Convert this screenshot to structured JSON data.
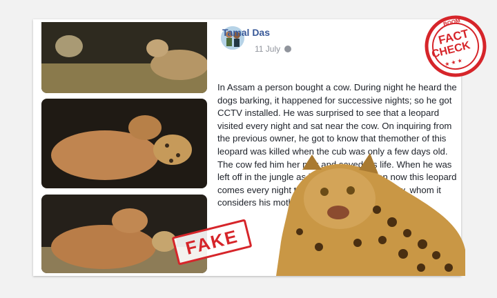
{
  "post": {
    "author": "Tamal Das",
    "date": "11 July",
    "privacy_icon": "globe-icon",
    "text": "In Assam a person bought a cow. During night he heard the dogs barking, it happened for successive nights; so he got CCTV installed. He was surprised to see that a leopard visited every night and sat near the cow. On inquiring from the previous owner, he got to know that themother of this leopard was killed when the cub was only a few days old. The cow fed him her milk and saved his life. When he was left off in the jungle as it grew up, but even now this leopard comes every night to meet his mother, the cow, whom it considers his mother."
  },
  "stamps": {
    "fake_label": "FAKE",
    "factcheck_top": "BOOM",
    "factcheck_word1": "FACT",
    "factcheck_word2": "CHECK",
    "factcheck_stars": "★ ★ ★"
  },
  "colors": {
    "stamp_red": "#d6252a",
    "author_blue": "#385898"
  }
}
